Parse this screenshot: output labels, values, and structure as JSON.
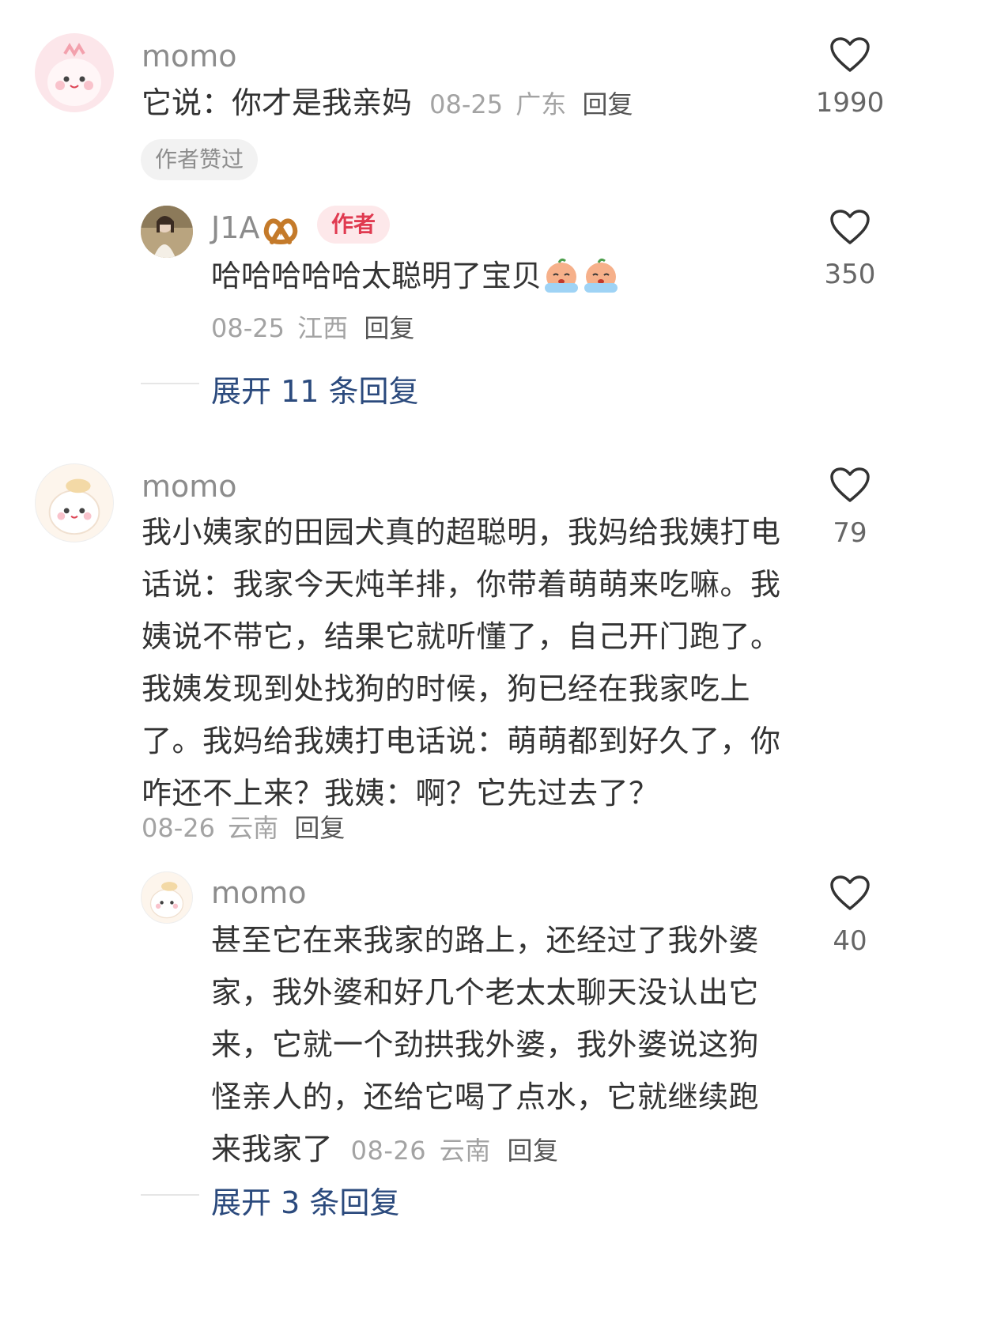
{
  "comments": [
    {
      "username": "momo",
      "text": "它说：你才是我亲妈",
      "date": "08-25",
      "location": "广东",
      "reply_label": "回复",
      "likes": "1990",
      "badge": "作者赞过",
      "replies": [
        {
          "username": "J1A",
          "author_badge": "作者",
          "text": "哈哈哈哈哈太聪明了宝贝",
          "date": "08-25",
          "location": "江西",
          "reply_label": "回复",
          "likes": "350"
        }
      ],
      "expand_label": "展开 11 条回复"
    },
    {
      "username": "momo",
      "text": "我小姨家的田园犬真的超聪明，我妈给我姨打电话说：我家今天炖羊排，你带着萌萌来吃嘛。我姨说不带它，结果它就听懂了，自己开门跑了。我姨发现到处找狗的时候，狗已经在我家吃上了。我妈给我姨打电话说：萌萌都到好久了，你咋还不上来？我姨：啊？它先过去了？",
      "date": "08-26",
      "location": "云南",
      "reply_label": "回复",
      "likes": "79",
      "replies": [
        {
          "username": "momo",
          "text": "甚至它在来我家的路上，还经过了我外婆家，我外婆和好几个老太太聊天没认出它来，它就一个劲拱我外婆，我外婆说这狗怪亲人的，还给它喝了点水，它就继续跑来我家了",
          "date": "08-26",
          "location": "云南",
          "reply_label": "回复",
          "likes": "40"
        }
      ],
      "expand_label": "展开 3 条回复"
    }
  ],
  "colors": {
    "text_primary": "#333333",
    "text_muted": "#8c8c8c",
    "link_blue": "#2b4a7d",
    "author_badge_bg": "#fde8ea",
    "author_badge_fg": "#e03a50"
  },
  "icons": [
    "heart-outline-icon",
    "pretzel-emoji",
    "crying-emoji"
  ]
}
